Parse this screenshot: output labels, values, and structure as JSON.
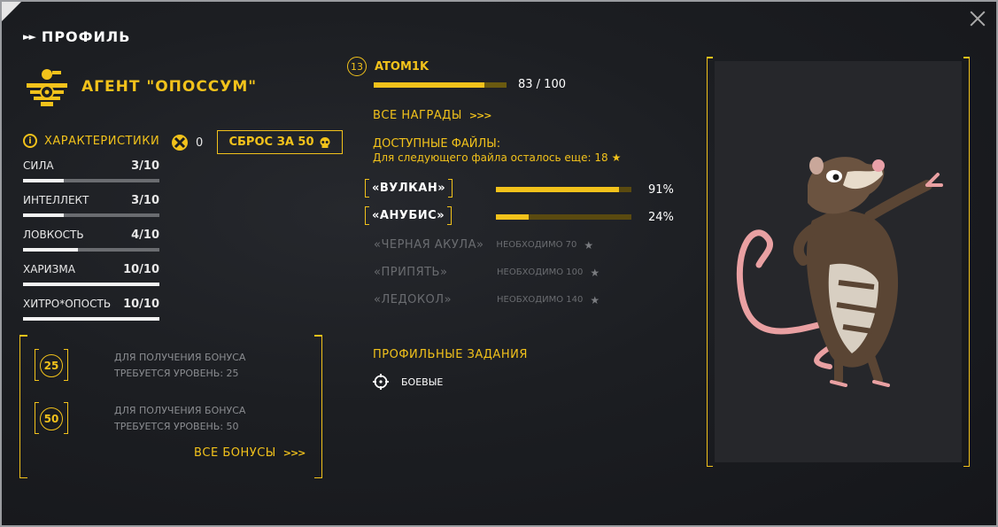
{
  "header": {
    "title": "ПРОФИЛЬ",
    "close_icon": "close-icon"
  },
  "agent": {
    "name": "АГЕНТ \"ОПОССУМ\"",
    "emblem_icon": "tribal-bird-emblem-icon"
  },
  "characteristics": {
    "label": "ХАРАКТЕРИСТИКИ",
    "points": "0",
    "reset_label": "СБРОС ЗА 50",
    "items": [
      {
        "name": "СИЛА",
        "value": "3/10",
        "fraction": 0.3
      },
      {
        "name": "ИНТЕЛЛЕКТ",
        "value": "3/10",
        "fraction": 0.3
      },
      {
        "name": "ЛОВКОСТЬ",
        "value": "4/10",
        "fraction": 0.4
      },
      {
        "name": "ХАРИЗМА",
        "value": "10/10",
        "fraction": 1.0
      },
      {
        "name": "ХИТРО*ОПОСТЬ",
        "value": "10/10",
        "fraction": 1.0
      }
    ]
  },
  "bonuses": {
    "items": [
      {
        "level": "25",
        "line1": "ДЛЯ ПОЛУЧЕНИЯ БОНУСА",
        "line2": "ТРЕБУЕТСЯ УРОВЕНЬ: 25"
      },
      {
        "level": "50",
        "line1": "ДЛЯ ПОЛУЧЕНИЯ БОНУСА",
        "line2": "ТРЕБУЕТСЯ УРОВЕНЬ: 50"
      }
    ],
    "all_label": "ВСЕ БОНУСЫ"
  },
  "player": {
    "level": "13",
    "name": "ATOM1K",
    "xp_text": "83 / 100",
    "xp_fraction": 0.83
  },
  "rewards": {
    "all_label": "ВСЕ НАГРАДЫ"
  },
  "files": {
    "label": "ДОСТУПНЫЕ ФАЙЛЫ:",
    "hint": "Для следующего файла осталось еще: 18",
    "active": [
      {
        "name": "«ВУЛКАН»",
        "percent": "91%",
        "fraction": 0.91
      },
      {
        "name": "«АНУБИС»",
        "percent": "24%",
        "fraction": 0.24
      }
    ],
    "locked": [
      {
        "name": "«ЧЕРНАЯ АКУЛА»",
        "req": "НЕОБХОДИМО 70"
      },
      {
        "name": "«ПРИПЯТЬ»",
        "req": "НЕОБХОДИМО 100"
      },
      {
        "name": "«ЛЕДОКОЛ»",
        "req": "НЕОБХОДИМО 140"
      }
    ]
  },
  "tasks": {
    "label": "ПРОФИЛЬНЫЕ ЗАДАНИЯ",
    "item": "БОЕВЫЕ"
  },
  "colors": {
    "accent": "#f2c21b",
    "panel": "#1c1e22",
    "muted": "#6a6c70"
  }
}
